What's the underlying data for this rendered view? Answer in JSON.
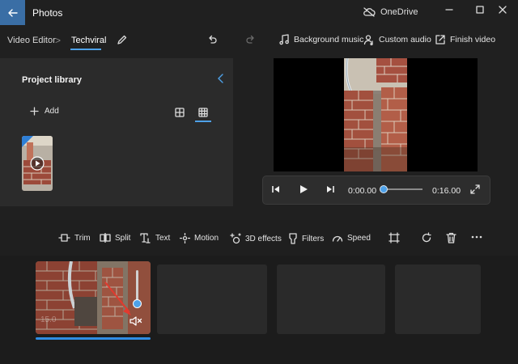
{
  "window": {
    "app_title": "Photos",
    "onedrive_label": "OneDrive",
    "back_icon": "back-arrow-icon"
  },
  "toolbar": {
    "breadcrumb_root": "Video Editor",
    "breadcrumb_separator": ">",
    "project_name": "Techviral",
    "background_music": "Background music",
    "custom_audio": "Custom audio",
    "finish_video": "Finish video"
  },
  "library": {
    "title": "Project library",
    "add_label": "Add"
  },
  "player": {
    "current_time": "0:00.00",
    "total_time": "0:16.00",
    "progress": 0
  },
  "edit_tools": {
    "trim": "Trim",
    "split": "Split",
    "text": "Text",
    "motion": "Motion",
    "effects_3d": "3D effects",
    "filters": "Filters",
    "speed": "Speed"
  },
  "storyboard": {
    "clip_duration": "15.0",
    "volume_muted": true
  },
  "colors": {
    "accent": "#4ea1e8",
    "titlebar_back": "#3a6ea5",
    "panel": "#2b2b2b"
  }
}
